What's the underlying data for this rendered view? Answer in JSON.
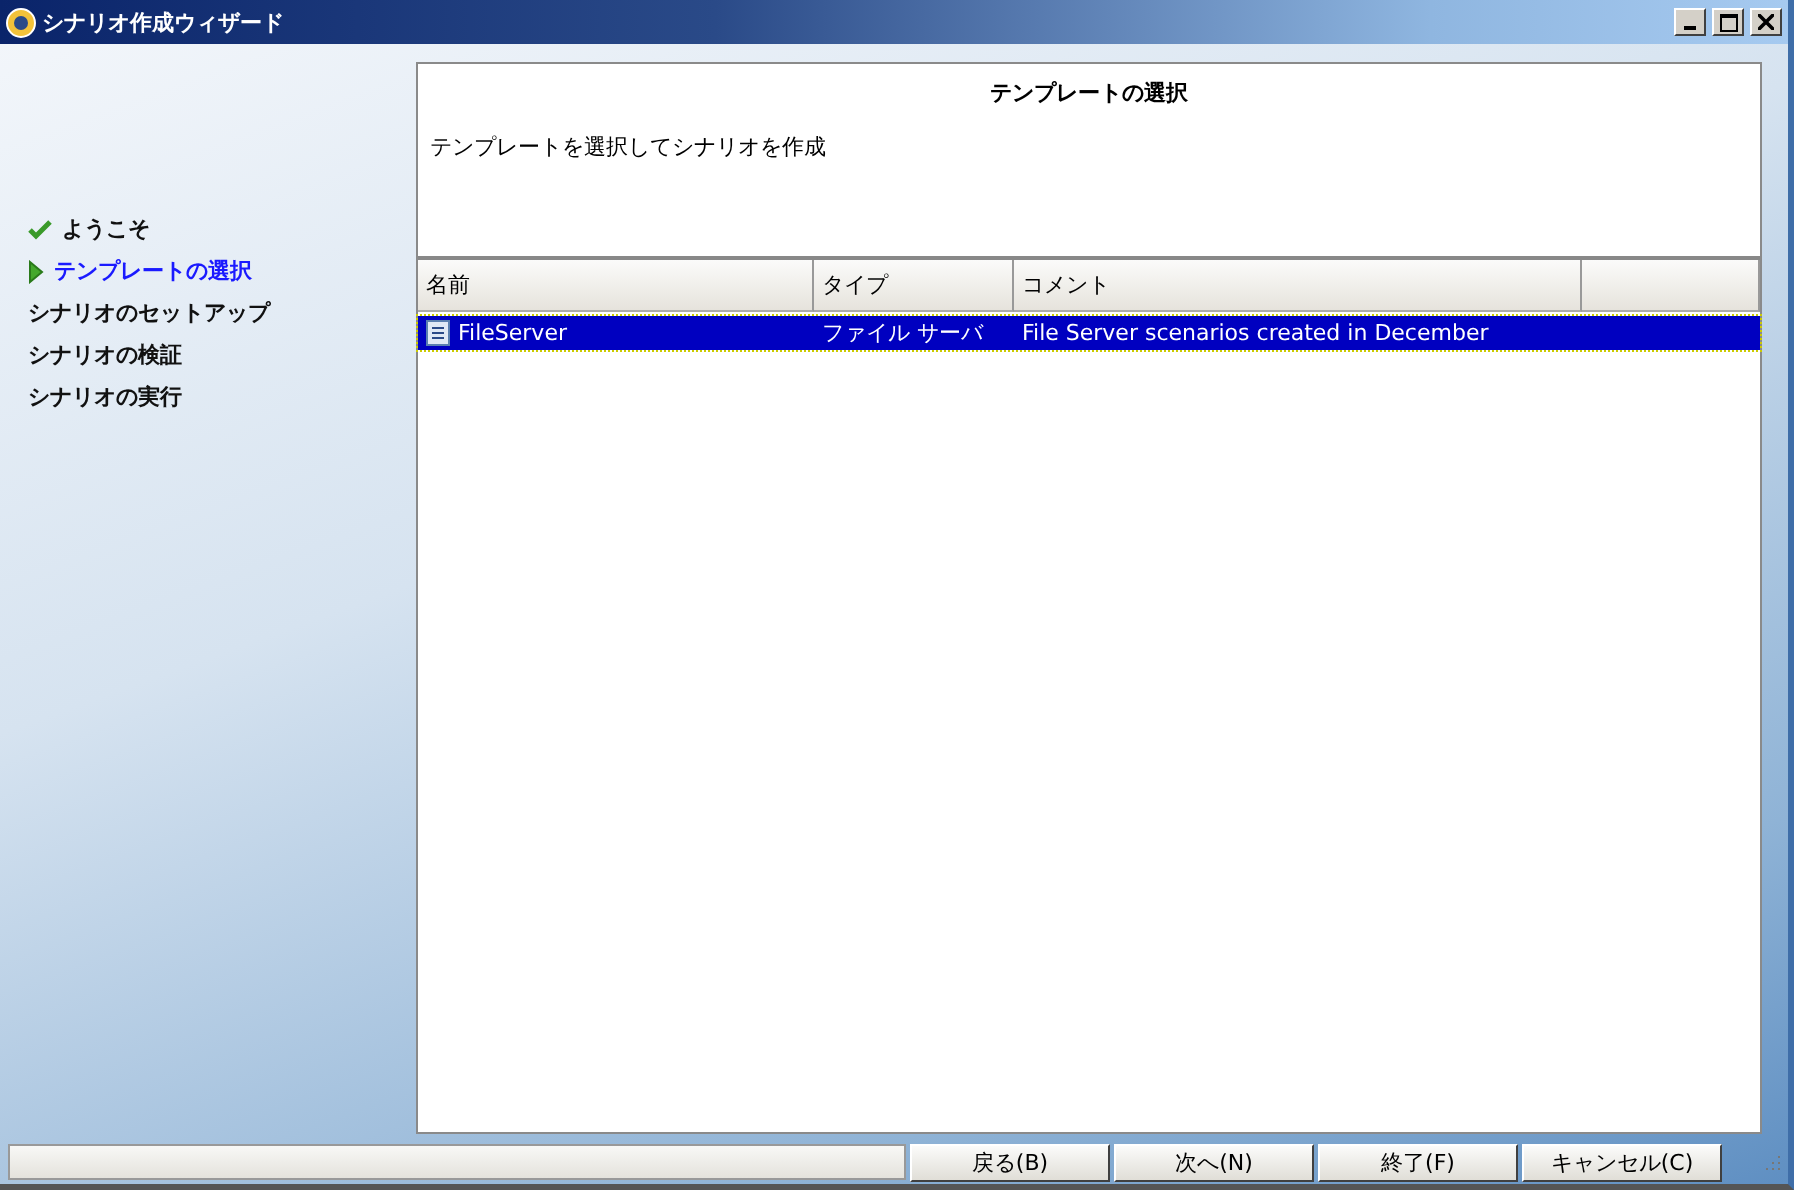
{
  "window": {
    "title": "シナリオ作成ウィザード"
  },
  "steps": [
    {
      "label": "ようこそ",
      "kind": "done"
    },
    {
      "label": "テンプレートの選択",
      "kind": "current"
    },
    {
      "label": "シナリオのセットアップ",
      "kind": "pending"
    },
    {
      "label": "シナリオの検証",
      "kind": "pending"
    },
    {
      "label": "シナリオの実行",
      "kind": "pending"
    }
  ],
  "page": {
    "title": "テンプレートの選択",
    "description": "テンプレートを選択してシナリオを作成"
  },
  "table": {
    "columns": [
      "名前",
      "タイプ",
      "コメント",
      null
    ],
    "rows": [
      {
        "cells": [
          "FileServer",
          "ファイル サーバ",
          "File Server scenarios created in December"
        ],
        "selected": true
      }
    ]
  },
  "buttons": [
    "戻る(B)",
    "次へ(N)",
    "終了(F)",
    "キャンセル(C)"
  ]
}
